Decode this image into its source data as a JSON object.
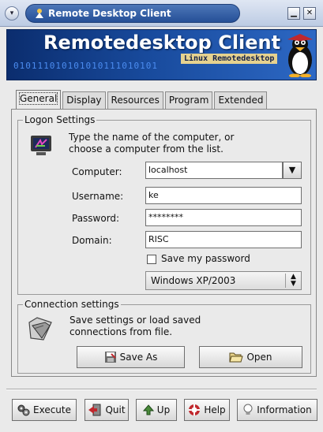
{
  "window": {
    "title": "Remote Desktop Client",
    "menu_glyph": "▾",
    "minimize_glyph": "▁",
    "close_glyph": "✕"
  },
  "banner": {
    "title": "Remotedesktop Client",
    "subtitle": "Linux Remotedesktop",
    "binary": "010111010101010111010101"
  },
  "tabs": [
    "General",
    "Display",
    "Resources",
    "Program",
    "Extended"
  ],
  "logon": {
    "legend": "Logon Settings",
    "description_line1": "Type the name of the computer, or",
    "description_line2": "choose a computer from the list.",
    "computer_label": "Computer:",
    "computer_value": "localhost",
    "username_label": "Username:",
    "username_value": "ke",
    "password_label": "Password:",
    "password_value": "********",
    "domain_label": "Domain:",
    "domain_value": "RISC",
    "save_password_label": "Save my password",
    "save_password_checked": false,
    "os_selected": "Windows XP/2003"
  },
  "connection": {
    "legend": "Connection settings",
    "description_line1": "Save settings or load saved",
    "description_line2": "connections from file.",
    "save_as_label": "Save As",
    "open_label": "Open"
  },
  "buttons": {
    "execute": "Execute",
    "quit": "Quit",
    "up": "Up",
    "help": "Help",
    "information": "Information"
  },
  "colors": {
    "title_pill": "#254f97",
    "banner": "#184a9c",
    "window_bg": "#eaeaea"
  }
}
